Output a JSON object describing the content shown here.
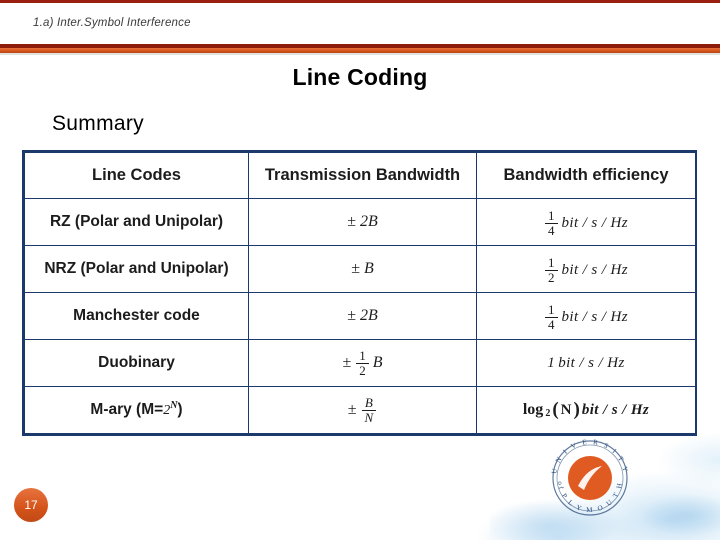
{
  "header": {
    "breadcrumb": "1.a) Inter.Symbol Interference"
  },
  "slide": {
    "title": "Line Coding",
    "subtitle": "Summary",
    "number": "17"
  },
  "table": {
    "headers": [
      "Line Codes",
      "Transmission Bandwidth",
      "Bandwidth efficiency"
    ],
    "rows": [
      {
        "code": "RZ (Polar and Unipolar)",
        "bandwidth_sign": "±",
        "bandwidth": "2B",
        "efficiency_num": "1",
        "efficiency_den": "4",
        "efficiency_unit": "bit / s / Hz"
      },
      {
        "code": "NRZ (Polar and Unipolar)",
        "bandwidth_sign": "±",
        "bandwidth": "B",
        "efficiency_num": "1",
        "efficiency_den": "2",
        "efficiency_unit": "bit / s / Hz"
      },
      {
        "code": "Manchester code",
        "bandwidth_sign": "±",
        "bandwidth": "2B",
        "efficiency_num": "1",
        "efficiency_den": "4",
        "efficiency_unit": "bit / s / Hz"
      },
      {
        "code": "Duobinary",
        "bandwidth_sign": "±",
        "bandwidth_frac_num": "1",
        "bandwidth_frac_den": "2",
        "bandwidth": "B",
        "efficiency_value": "1",
        "efficiency_unit": "bit / s / Hz"
      },
      {
        "code_prefix": "M-ary (M=",
        "code_base": "2",
        "code_exp": "N",
        "code_suffix": ")",
        "bandwidth_sign": "±",
        "bandwidth_frac_num": "B",
        "bandwidth_frac_den": "N",
        "efficiency_log": "log",
        "efficiency_log_sub": "2",
        "efficiency_log_arg": "N",
        "efficiency_unit": "bit / s / Hz"
      }
    ]
  },
  "logo": {
    "text_top": "UNIVERSITY",
    "text_bottom": "of PLYMOUTH"
  },
  "colors": {
    "accent_orange": "#d4531b",
    "accent_dark_red": "#8d1c0c",
    "table_border": "#1b3a6b"
  }
}
